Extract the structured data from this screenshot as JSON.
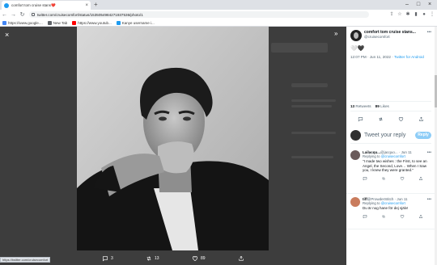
{
  "browser": {
    "tab_title": "comfort tom cruise stans❤️",
    "tab_close": "×",
    "new_tab": "+",
    "win_min": "–",
    "win_max": "□",
    "win_close": "×",
    "url": "twitter.com/cruisecomfort/status/1535054984271937536/photo/1",
    "bookmarks": [
      {
        "label": "https://www.google....",
        "color": "#4285f4"
      },
      {
        "label": "New Tab",
        "color": "#5f6368"
      },
      {
        "label": "https://www.youtub...",
        "color": "#ff0000"
      },
      {
        "label": "Kanye username i...",
        "color": "#1d9bf0"
      }
    ]
  },
  "viewer": {
    "close_icon": "×",
    "expand_icon": "»",
    "actions": {
      "reply_count": "3",
      "retweet_count": "13",
      "like_count": "89"
    },
    "status_url": "https://twitter.com/cruisecomfort"
  },
  "tweet": {
    "display_name": "comfort tom cruise stans...",
    "handle": "@cruisecomfort",
    "more": "•••",
    "emoji": "🤍🖤",
    "meta_time": "12:07 PM · Jun 11, 2022 · ",
    "meta_source": "Twitter for Android",
    "retweets_count": "13",
    "retweets_label": "Retweets",
    "likes_count": "89",
    "likes_label": "Likes"
  },
  "reply_composer": {
    "placeholder": "Tweet your reply",
    "button": "Reply"
  },
  "replies": [
    {
      "name": "Lailacqu...",
      "sub": " @jacquo... · Jun 11",
      "replying_prefix": "Replying to ",
      "replying_to": "@cruisecomfort",
      "text": "\"I made two wishes : the First, to see an Angel, the Second, Love… When I Saw you, I knew they were granted.\"",
      "avatar_color": "#6b5b5b"
    },
    {
      "name": "tiff",
      "sub": " @ProwderStitch · Jun 11",
      "replying_prefix": "Replying to ",
      "replying_to": "@cruisecomfort",
      "text": "Du är nog hane för dej själv!",
      "avatar_color": "#c97c5d"
    }
  ],
  "colors": {
    "accent": "#1d9bf0",
    "backdrop": "#3d3d3d",
    "reply_button": "#8ecdf7"
  },
  "icons": [
    "reply-icon",
    "retweet-icon",
    "like-icon",
    "share-icon",
    "close-icon",
    "expand-icon",
    "lock-icon"
  ]
}
